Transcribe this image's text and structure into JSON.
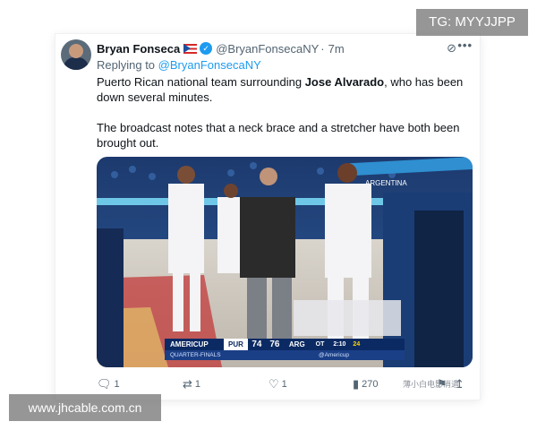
{
  "tweet": {
    "author_name": "Bryan Fonseca",
    "author_handle": "@BryanFonsecaNY",
    "separator": "·",
    "timestamp": "7m",
    "reply_prefix": "Replying to",
    "reply_handle": "@BryanFonsecaNY",
    "text_p1_before": "Puerto Rican national team surrounding ",
    "text_p1_bold": "Jose Alvarado",
    "text_p1_after": ", who has been down several minutes.",
    "text_p2": "The broadcast notes that a neck brace and a stretcher have both been brought out.",
    "icons": [
      "avatar",
      "puerto-rico-flag-icon",
      "verified-icon",
      "grok-icon",
      "more-icon"
    ]
  },
  "media": {
    "scoreboard": {
      "league": "AMERICUP",
      "round": "QUARTER-FINALS",
      "team1": "PUR",
      "score1": "74",
      "score2": "76",
      "team2": "ARG",
      "period": "OT",
      "clock": "2:10",
      "shot_clock": "24",
      "broadcast_handle": "@Americup"
    },
    "banner_text": "ARGENTINA"
  },
  "actions": {
    "reply_count": "1",
    "retweet_count": "1",
    "like_count": "1",
    "views_count": "270"
  },
  "overlays": {
    "tg_label": "TG: MYYJJPP",
    "site_label": "www.jhcable.com.cn",
    "watermark": "薄小白电影消遣"
  },
  "colors": {
    "accent_blue": "#1d9bf0",
    "text_primary": "#0f1419",
    "text_secondary": "#536471",
    "scoreboard_navy": "#0b2a63"
  }
}
